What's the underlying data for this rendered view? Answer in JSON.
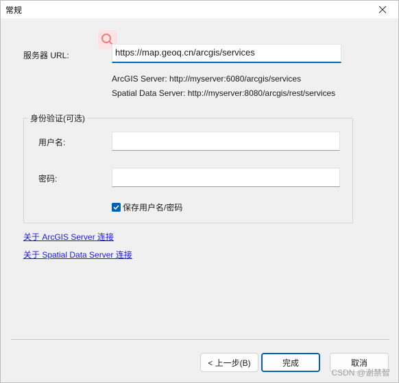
{
  "window": {
    "title": "常规",
    "close_glyph": "✕"
  },
  "server": {
    "url_label": "服务器 URL:",
    "url_value": "https://map.geoq.cn/arcgis/services",
    "hint_arcgis": "ArcGIS Server: http://myserver:6080/arcgis/services",
    "hint_spatial": "Spatial Data Server: http://myserver:8080/arcgis/rest/services"
  },
  "auth": {
    "group_title": "身份验证(可选)",
    "username_label": "用户名:",
    "username_value": "",
    "password_label": "密码:",
    "password_value": "",
    "save_label": "保存用户名/密码",
    "save_checked": true
  },
  "links": {
    "arcgis": "关于 ArcGIS Server 连接",
    "spatial": "关于 Spatial Data Server 连接"
  },
  "buttons": {
    "back": "< 上一步(B)",
    "finish": "完成",
    "cancel": "取消"
  },
  "watermark": "CSDN @谢禁智",
  "colors": {
    "accent": "#005fb8",
    "link": "#1a1adb"
  }
}
